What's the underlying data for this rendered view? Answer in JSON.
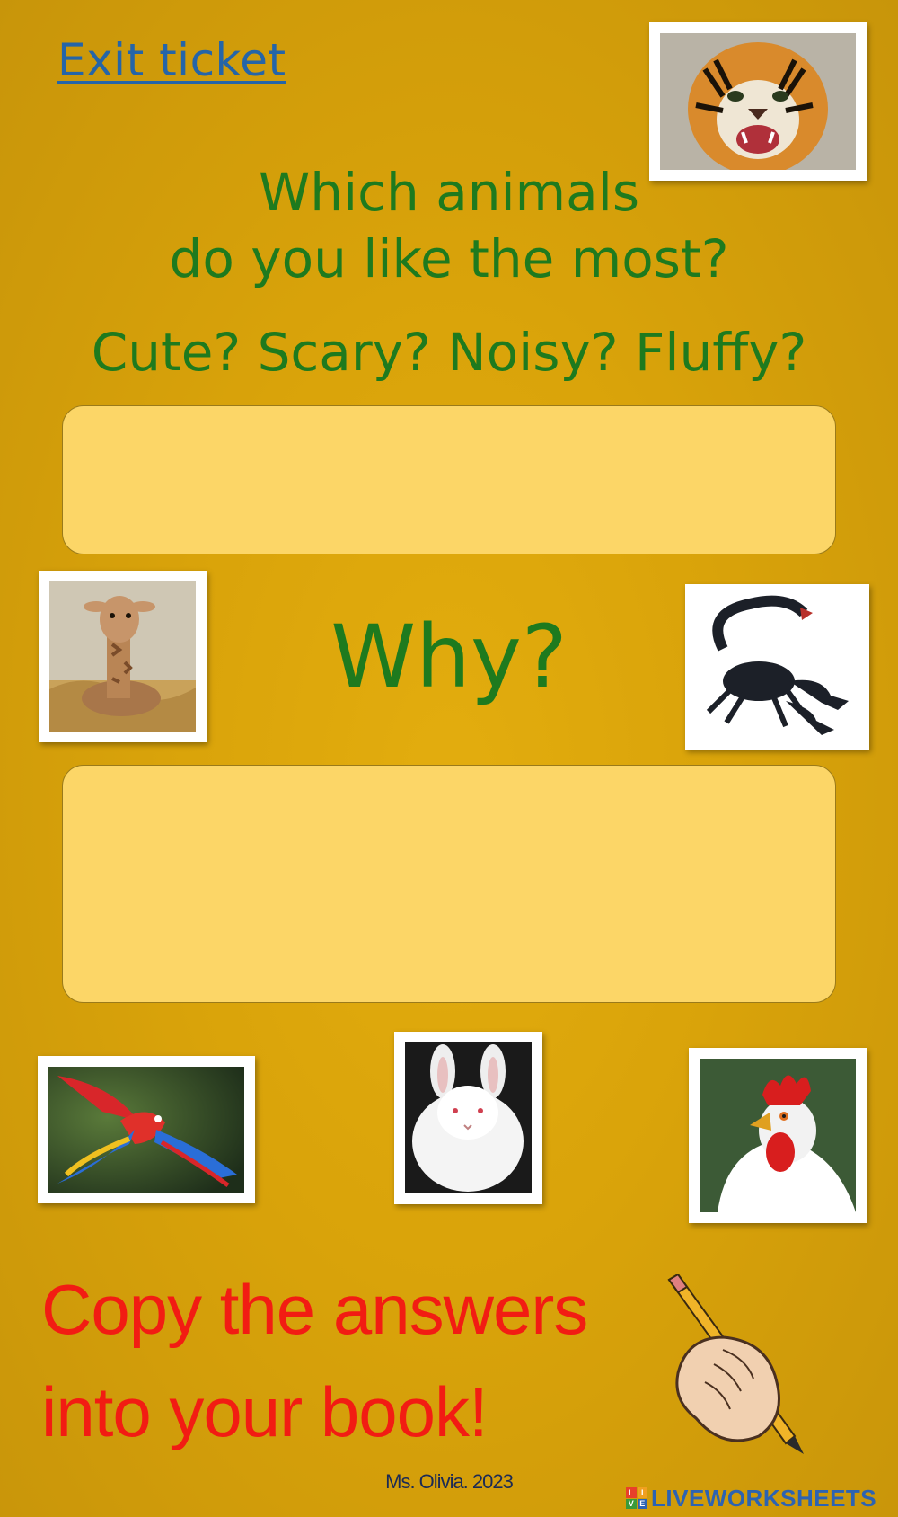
{
  "header": {
    "title_link": "Exit ticket"
  },
  "prompt": {
    "line1": "Which animals",
    "line2": "do you like the most?",
    "sub": "Cute? Scary? Noisy? Fluffy?",
    "why": "Why?"
  },
  "answers": {
    "box1_value": "",
    "box2_value": ""
  },
  "pictures": {
    "tiger": "tiger-photo",
    "giraffe": "baby-giraffe-photo",
    "scorpion": "scorpion-photo",
    "parrot": "parrot-photo",
    "rabbit": "angora-rabbit-photo",
    "rooster": "rooster-photo",
    "hand": "hand-writing-pencil-icon"
  },
  "footer": {
    "instruction_line1": "Copy the answers",
    "instruction_line2": "into your book!",
    "signature": "Ms. Olivia. 2023",
    "brand": "LIVEWORKSHEETS",
    "brand_logo_letters": [
      "L",
      "I",
      "V",
      "E"
    ]
  },
  "colors": {
    "background": "#dca60d",
    "title_blue": "#2565a8",
    "question_green": "#1e7a1e",
    "instruction_red": "#f21c13",
    "answer_box": "#fcd667"
  }
}
